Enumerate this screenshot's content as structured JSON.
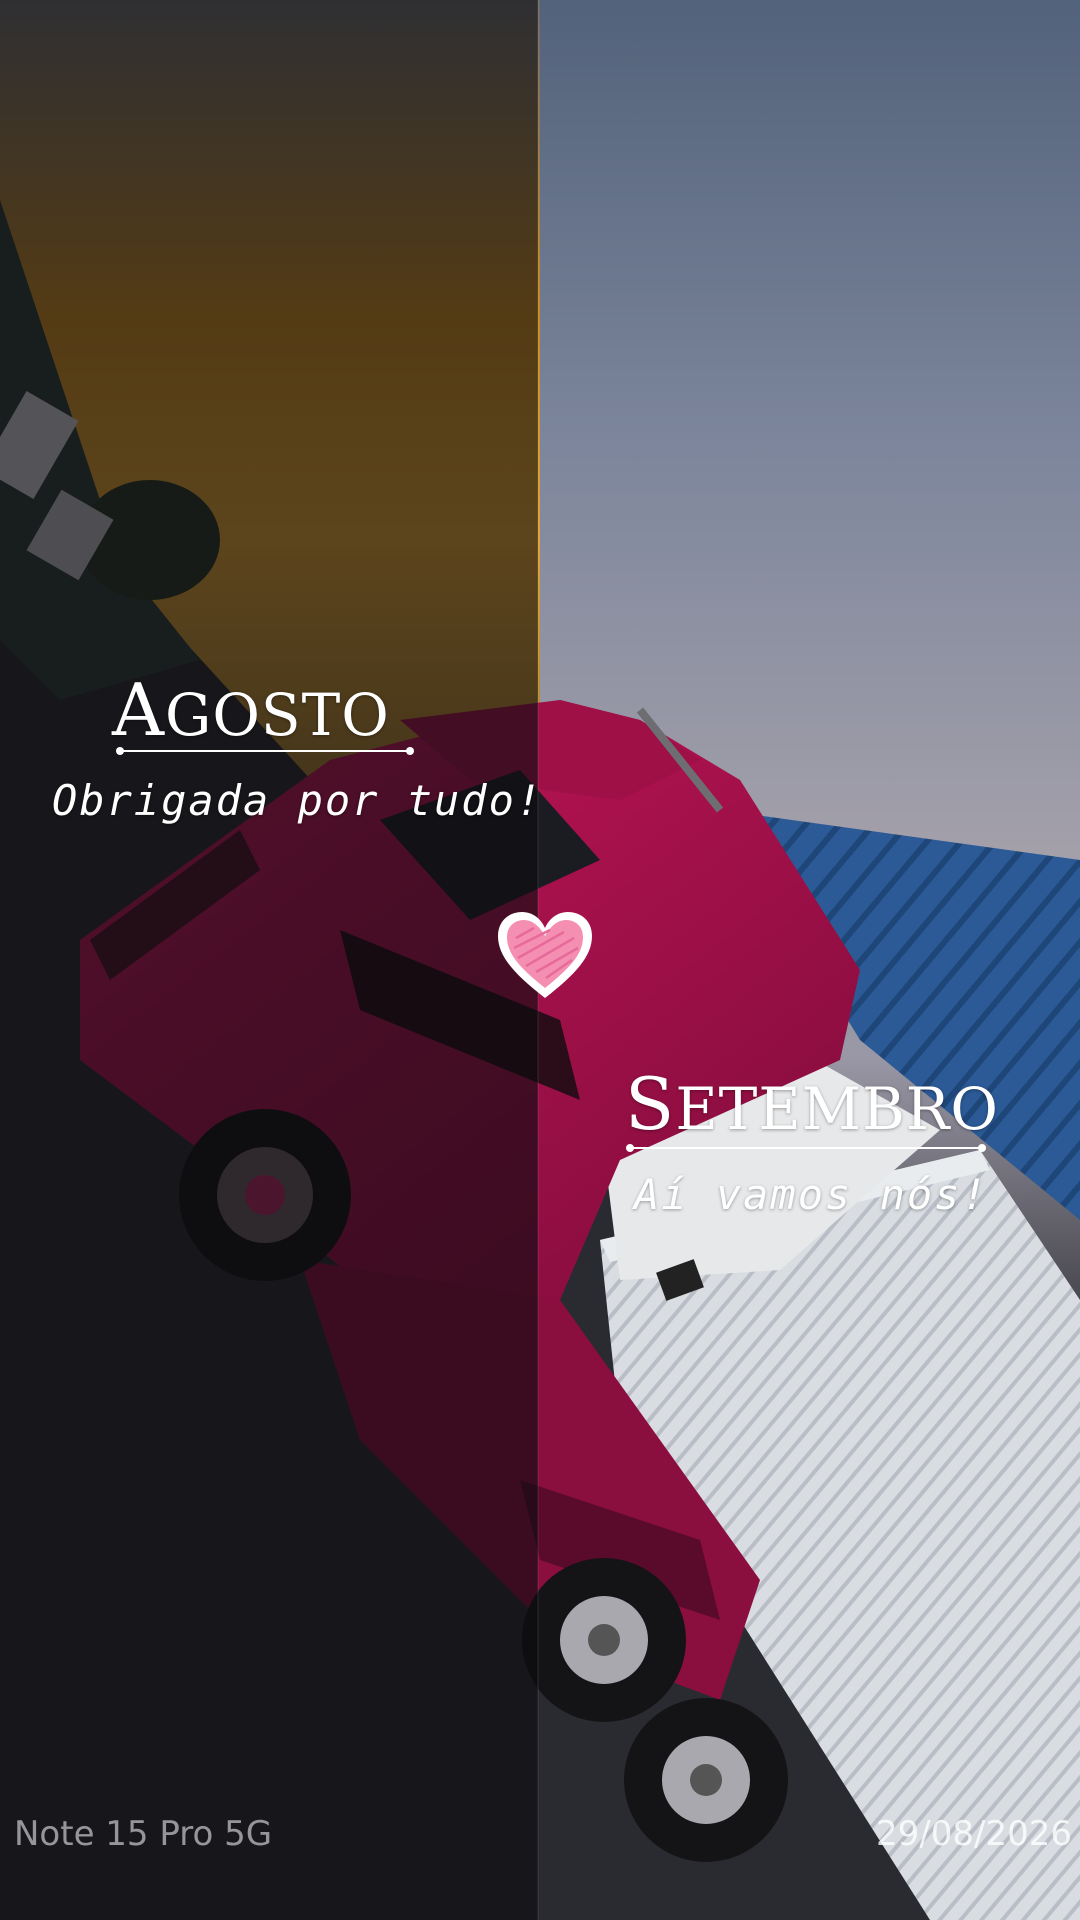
{
  "left": {
    "title_initial": "A",
    "title_rest": "GOSTO",
    "subtitle": "Obrigada por tudo!"
  },
  "right": {
    "title_initial": "S",
    "title_rest": "ETEMBRO",
    "subtitle": "Aí vamos nós!"
  },
  "footer": {
    "device": "Note 15 Pro 5G",
    "date": "29/08/2026"
  },
  "colors": {
    "heart_fill": "#f48fb1",
    "truck_cab": "#b0124f",
    "roof_blue": "#2c5d9c",
    "trailer": "#d7dbe0"
  },
  "icons": {
    "heart": "heart-icon"
  }
}
